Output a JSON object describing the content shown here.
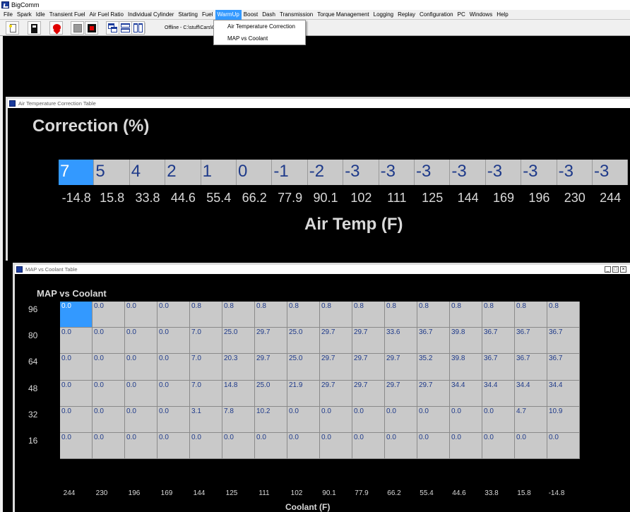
{
  "app": {
    "title": "BigComm",
    "offline_status": "Offline - C:\\stuff\\Cars\\G"
  },
  "menu": [
    "File",
    "Spark",
    "Idle",
    "Transient Fuel",
    "Air Fuel Ratio",
    "Individual Cylinder",
    "Starting",
    "Fuel",
    "WarmUp",
    "Boost",
    "Dash",
    "Transmission",
    "Torque Management",
    "Logging",
    "Replay",
    "Configuration",
    "PC",
    "Windows",
    "Help"
  ],
  "active_menu": "WarmUp",
  "dropdown": [
    "Air Temperature Correction",
    "MAP vs Coolant"
  ],
  "toolbar_icons": [
    "new-file-icon",
    "fuel-pump-icon",
    "heart-icon",
    "stop-icon",
    "chip-icon",
    "cascade-windows-icon",
    "tile-horizontal-icon",
    "tile-vertical-icon"
  ],
  "air_window": {
    "title": "Air Temperature Correction Table",
    "heading": "Correction (%)",
    "values": [
      "7",
      "5",
      "4",
      "2",
      "1",
      "0",
      "-1",
      "-2",
      "-3",
      "-3",
      "-3",
      "-3",
      "-3",
      "-3",
      "-3",
      "-3"
    ],
    "temps": [
      "-14.8",
      "15.8",
      "33.8",
      "44.6",
      "55.4",
      "66.2",
      "77.9",
      "90.1",
      "102",
      "111",
      "125",
      "144",
      "169",
      "196",
      "230",
      "244"
    ],
    "axis_label": "Air Temp (F)",
    "selected_index": 0
  },
  "map_window": {
    "title": "MAP vs Coolant Table",
    "heading": "MAP vs Coolant",
    "row_labels": [
      "96",
      "80",
      "64",
      "48",
      "32",
      "16"
    ],
    "col_labels": [
      "244",
      "230",
      "196",
      "169",
      "144",
      "125",
      "111",
      "102",
      "90.1",
      "77.9",
      "66.2",
      "55.4",
      "44.6",
      "33.8",
      "15.8",
      "-14.8"
    ],
    "rows": [
      [
        "0.0",
        "0.0",
        "0.0",
        "0.0",
        "0.8",
        "0.8",
        "0.8",
        "0.8",
        "0.8",
        "0.8",
        "0.8",
        "0.8",
        "0.8",
        "0.8",
        "0.8",
        "0.8"
      ],
      [
        "0.0",
        "0.0",
        "0.0",
        "0.0",
        "7.0",
        "25.0",
        "29.7",
        "25.0",
        "29.7",
        "29.7",
        "33.6",
        "36.7",
        "39.8",
        "36.7",
        "36.7",
        "36.7"
      ],
      [
        "0.0",
        "0.0",
        "0.0",
        "0.0",
        "7.0",
        "20.3",
        "29.7",
        "25.0",
        "29.7",
        "29.7",
        "29.7",
        "35.2",
        "39.8",
        "36.7",
        "36.7",
        "36.7"
      ],
      [
        "0.0",
        "0.0",
        "0.0",
        "0.0",
        "7.0",
        "14.8",
        "25.0",
        "21.9",
        "29.7",
        "29.7",
        "29.7",
        "29.7",
        "34.4",
        "34.4",
        "34.4",
        "34.4"
      ],
      [
        "0.0",
        "0.0",
        "0.0",
        "0.0",
        "3.1",
        "7.8",
        "10.2",
        "0.0",
        "0.0",
        "0.0",
        "0.0",
        "0.0",
        "0.0",
        "0.0",
        "4.7",
        "10.9"
      ],
      [
        "0.0",
        "0.0",
        "0.0",
        "0.0",
        "0.0",
        "0.0",
        "0.0",
        "0.0",
        "0.0",
        "0.0",
        "0.0",
        "0.0",
        "0.0",
        "0.0",
        "0.0",
        "0.0"
      ]
    ],
    "axis_label": "Coolant (F)",
    "selected": [
      0,
      0
    ]
  },
  "colors": {
    "selection": "#3399ff",
    "cell_bg": "#c9c9c9",
    "cell_text": "#1e3a8a",
    "label_text": "#d9d9d9"
  }
}
